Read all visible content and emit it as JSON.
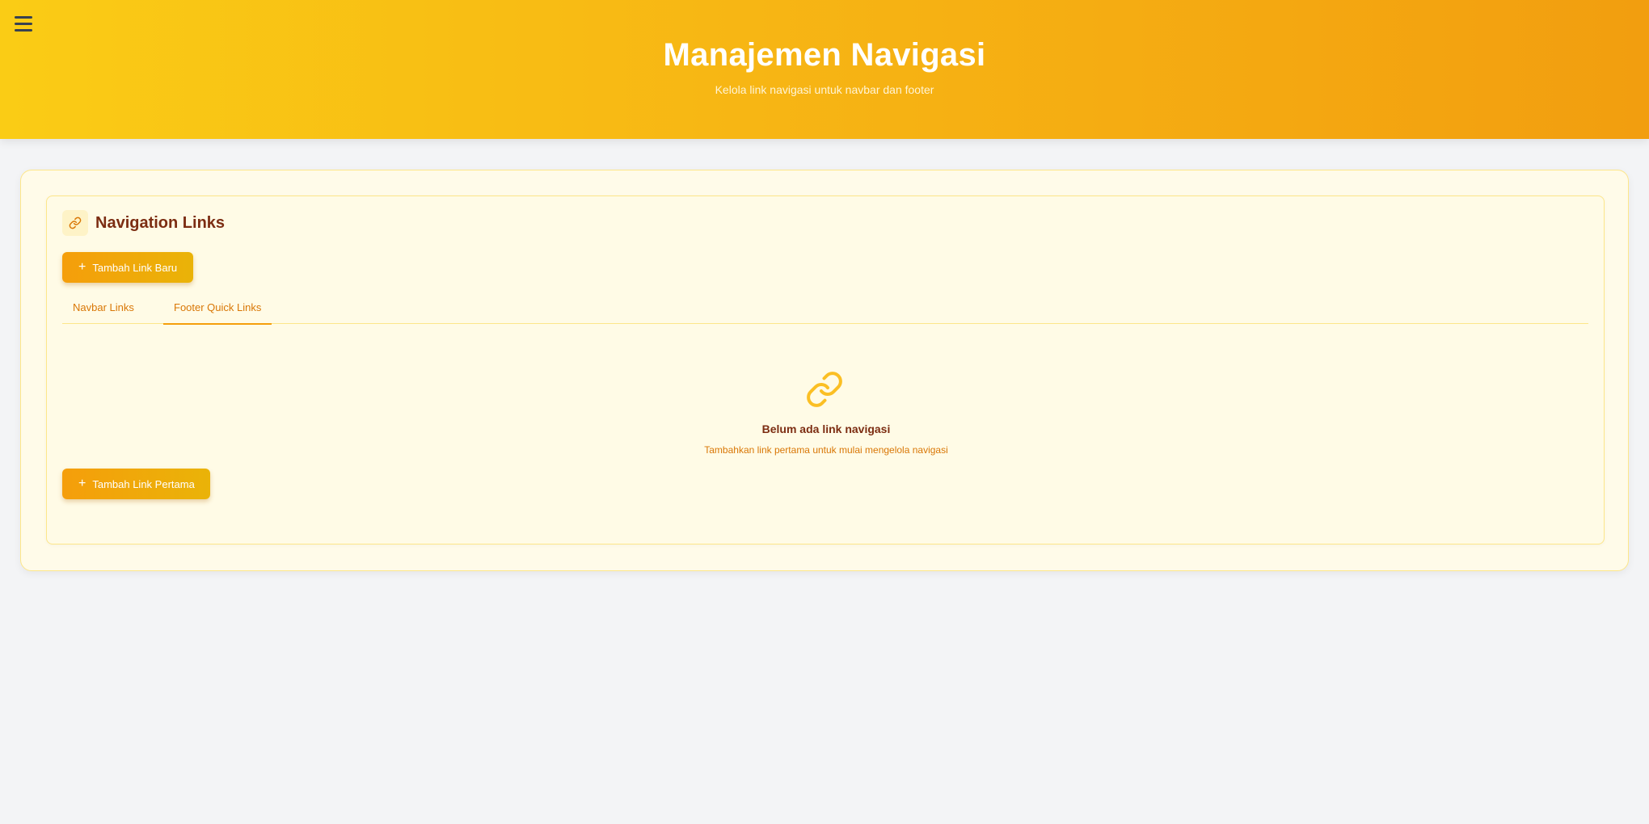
{
  "header": {
    "title": "Manajemen Navigasi",
    "subtitle": "Kelola link navigasi untuk navbar dan footer",
    "menu_icon": "hamburger-menu-icon"
  },
  "card": {
    "title": "Navigation Links",
    "icon": "link-icon",
    "add_button": "Tambah Link Baru",
    "tabs": [
      {
        "label": "Navbar Links",
        "active": false
      },
      {
        "label": "Footer Quick Links",
        "active": true
      }
    ],
    "empty_state": {
      "icon": "link-icon",
      "title": "Belum ada link navigasi",
      "description": "Tambahkan link pertama untuk mulai mengelola navigasi",
      "button": "Tambah Link Pertama"
    }
  },
  "colors": {
    "header_gradient_start": "#facc15",
    "header_gradient_end": "#f29e0f",
    "accent": "#f59e0b",
    "title_text": "#7c2d12",
    "tab_text": "#d97706"
  }
}
